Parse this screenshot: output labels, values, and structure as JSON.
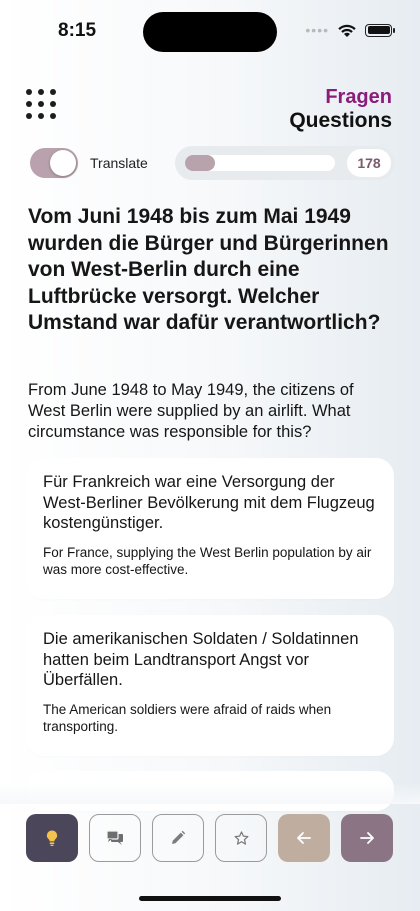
{
  "status_bar": {
    "time": "8:15"
  },
  "header": {
    "title_de": "Fragen",
    "title_en": "Questions"
  },
  "translate": {
    "label": "Translate",
    "enabled": true
  },
  "progress": {
    "count": "178",
    "fraction": 0.2
  },
  "question": {
    "text_de": "Vom Juni 1948 bis zum Mai 1949 wurden die Bürger und Bürgerinnen von West-Berlin durch eine Luftbrücke versorgt. Welcher Umstand war dafür verantwortlich?",
    "text_en": "From June 1948 to May 1949, the citizens of West Berlin were supplied by an airlift. What circumstance was responsible for this?"
  },
  "answers": [
    {
      "text_de": "Für Frankreich war eine Versorgung der West-Berliner Bevölkerung mit dem Flugzeug kostengünstiger.",
      "text_en": "For France, supplying the West Berlin population by air was more cost-effective."
    },
    {
      "text_de": "Die amerikanischen Soldaten / Soldatinnen hatten beim Landtransport Angst vor Überfällen.",
      "text_en": "The American soldiers were afraid of raids when transporting."
    }
  ],
  "colors": {
    "accent": "#8a1c7a",
    "toggle_on": "#b9a2ad",
    "hint_button": "#4b4659",
    "prev_button": "#bfaea0",
    "next_button": "#8b7584"
  },
  "toolbar": {
    "icons": [
      "lightbulb-icon",
      "chat-icon",
      "pencil-icon",
      "star-icon",
      "arrow-left-icon",
      "arrow-right-icon"
    ]
  }
}
